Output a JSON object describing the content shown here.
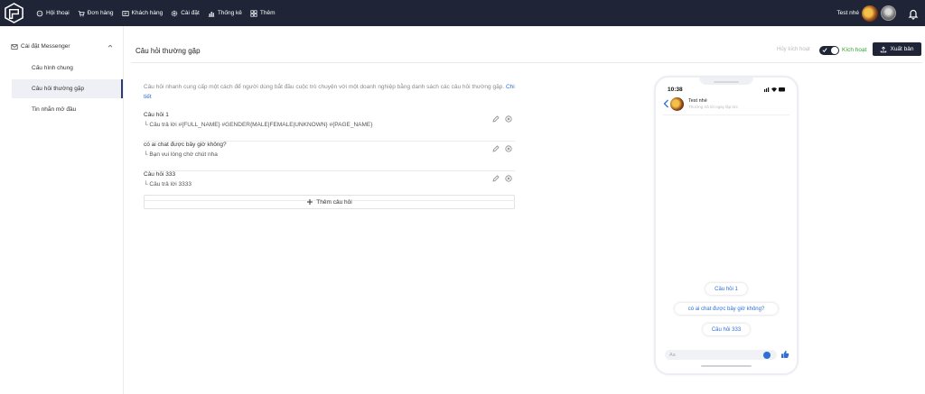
{
  "nav": {
    "items": [
      {
        "label": "Hội thoại",
        "icon": "chat-icon"
      },
      {
        "label": "Đơn hàng",
        "icon": "cart-icon"
      },
      {
        "label": "Khách hàng",
        "icon": "contacts-icon"
      },
      {
        "label": "Cài đặt",
        "icon": "gear-icon"
      },
      {
        "label": "Thống kê",
        "icon": "bar-chart-icon"
      },
      {
        "label": "Thêm",
        "icon": "grid-icon"
      }
    ],
    "user_name": "Test nhé"
  },
  "sidebar": {
    "group_label": "Cài đặt Messenger",
    "items": [
      {
        "label": "Cấu hình chung",
        "active": false
      },
      {
        "label": "Câu hỏi thường gặp",
        "active": true
      },
      {
        "label": "Tin nhắn mở đầu",
        "active": false
      }
    ]
  },
  "header": {
    "title": "Câu hỏi thường gặp",
    "deactivate_label": "Hủy kích hoạt",
    "activate_label": "Kích hoạt",
    "toggle_on": true,
    "publish_label": "Xuất bản"
  },
  "main": {
    "description": "Câu hỏi nhanh cung cấp một cách để người dùng bắt đầu cuộc trò chuyện với một doanh nghiệp bằng danh sách các câu hỏi thường gặp.",
    "detail_link": "Chi tiết",
    "faqs": [
      {
        "question": "Câu hỏi 1",
        "answer": "Câu trả lời #{FULL_NAME} #GENDER{MALE|FEMALE|UNKNOWN} #{PAGE_NAME}"
      },
      {
        "question": "có ai chat được bây giờ không?",
        "answer": "Bạn vui lòng chờ chút nha"
      },
      {
        "question": "Câu hỏi 333",
        "answer": "Câu trả lời 3333"
      }
    ],
    "add_label": "Thêm câu hỏi"
  },
  "phone": {
    "time": "10:38",
    "page_name": "Test nhé",
    "subtitle": "Thường trả lời ngay lập tức",
    "chips": [
      "Câu hỏi 1",
      "có ai chat được bây giờ không?",
      "Câu hỏi 333"
    ],
    "input_placeholder": "Aa"
  },
  "colors": {
    "topbar": "#1f2536",
    "accent_blue": "#2f6fd6",
    "active_green": "#2fa62f"
  }
}
